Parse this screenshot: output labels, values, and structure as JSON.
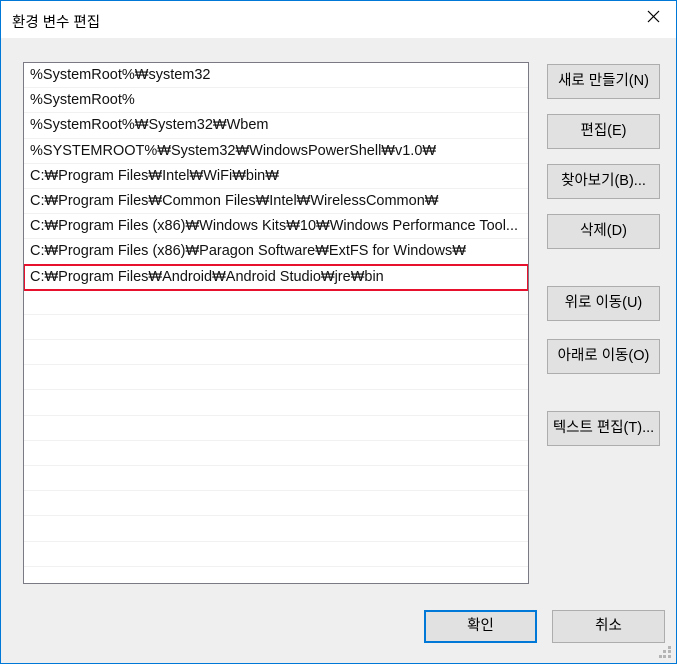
{
  "window": {
    "title": "환경 변수 편집",
    "close_icon": "close-icon",
    "accent_color": "#0078d7",
    "body_color": "#efefef",
    "highlight_color": "#e8112d"
  },
  "list": {
    "items": [
      "%SystemRoot%₩system32",
      "%SystemRoot%",
      "%SystemRoot%₩System32₩Wbem",
      "%SYSTEMROOT%₩System32₩WindowsPowerShell₩v1.0₩",
      "C:₩Program Files₩Intel₩WiFi₩bin₩",
      "C:₩Program Files₩Common Files₩Intel₩WirelessCommon₩",
      "C:₩Program Files (x86)₩Windows Kits₩10₩Windows Performance Tool...",
      "C:₩Program Files (x86)₩Paragon Software₩ExtFS for Windows₩",
      "C:₩Program Files₩Android₩Android Studio₩jre₩bin"
    ],
    "highlighted_index": 8,
    "empty_row_count": 11
  },
  "side_buttons": {
    "new": "새로 만들기(N)",
    "edit": "편집(E)",
    "browse": "찾아보기(B)...",
    "delete": "삭제(D)",
    "move_up": "위로 이동(U)",
    "move_down": "아래로 이동(O)",
    "edit_text": "텍스트 편집(T)..."
  },
  "bottom_buttons": {
    "ok": "확인",
    "cancel": "취소"
  }
}
